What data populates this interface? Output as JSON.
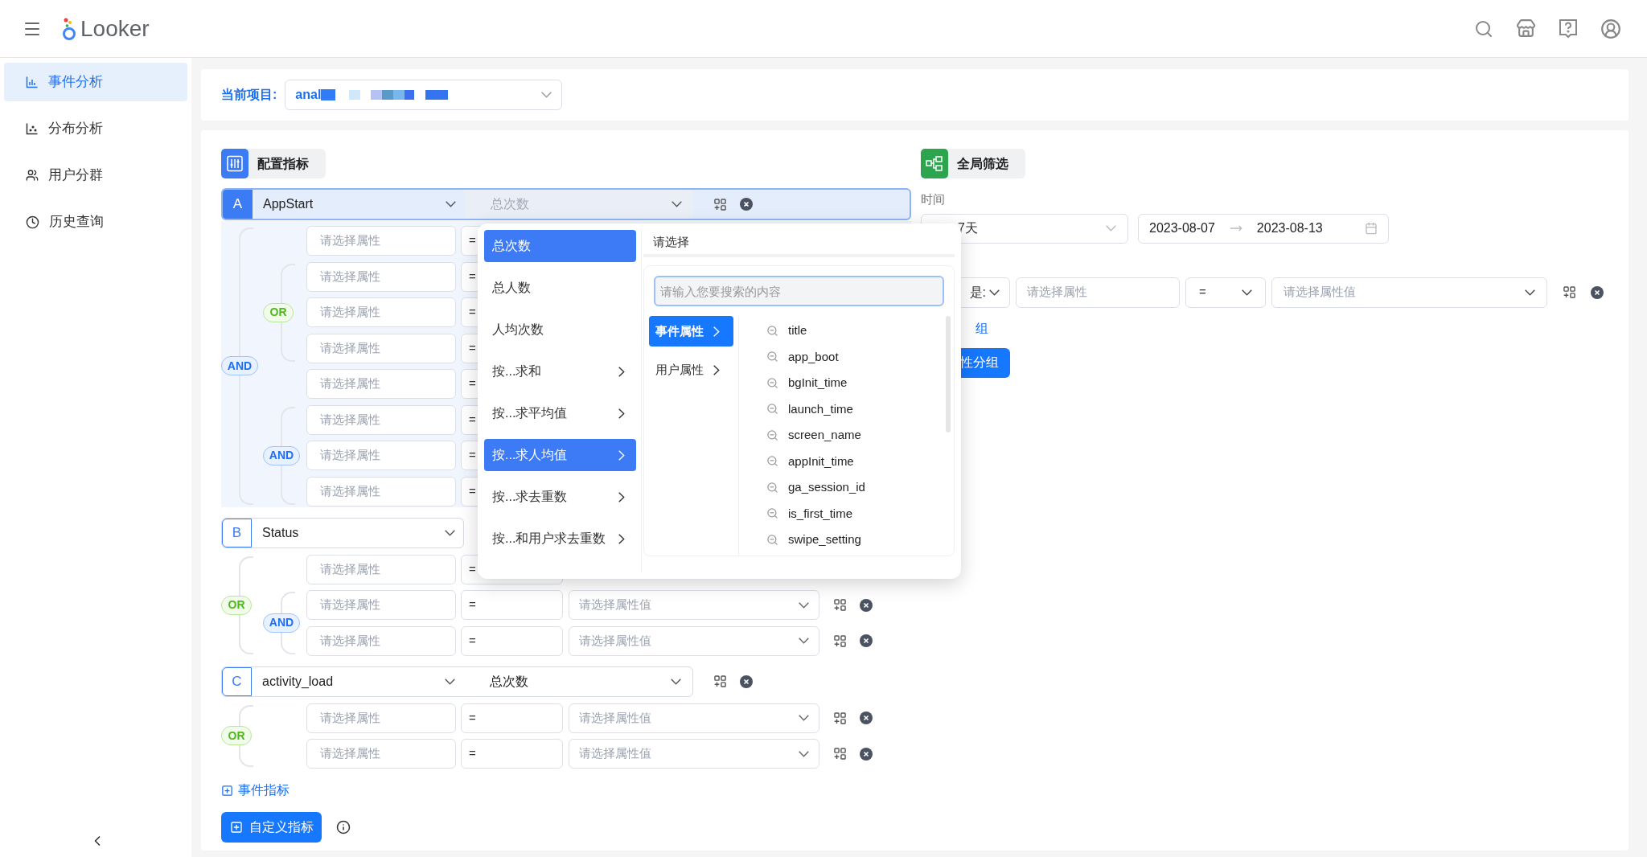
{
  "header": {
    "logo": "Looker"
  },
  "sidebar": {
    "items": [
      {
        "label": "事件分析",
        "kind": "bars",
        "selected": true
      },
      {
        "label": "分布分析",
        "kind": "scatter",
        "selected": false
      },
      {
        "label": "用户分群",
        "kind": "users",
        "selected": false
      },
      {
        "label": "历史查询",
        "kind": "clock",
        "selected": false
      }
    ]
  },
  "project": {
    "label": "当前项目:",
    "value": "anal"
  },
  "config": {
    "title": "配置指标",
    "metrics": [
      {
        "letter": "A",
        "event": "AppStart",
        "aggregate": "总次数",
        "active": true,
        "filters": {
          "kind": "and",
          "label": "AND",
          "children": [
            {
              "kind": "row",
              "property": "请选择属性",
              "operator": "="
            },
            {
              "kind": "or",
              "label": "OR",
              "children": [
                {
                  "kind": "row",
                  "property": "请选择属性",
                  "operator": "="
                },
                {
                  "kind": "row",
                  "property": "请选择属性",
                  "operator": "="
                },
                {
                  "kind": "row",
                  "property": "请选择属性",
                  "operator": "="
                }
              ]
            },
            {
              "kind": "row",
              "property": "请选择属性",
              "operator": "="
            },
            {
              "kind": "and",
              "label": "AND",
              "children": [
                {
                  "kind": "row",
                  "property": "请选择属性",
                  "operator": "="
                },
                {
                  "kind": "row",
                  "property": "请选择属性",
                  "operator": "="
                },
                {
                  "kind": "row",
                  "property": "请选择属性",
                  "operator": "="
                }
              ]
            }
          ]
        }
      },
      {
        "letter": "B",
        "event": "Status",
        "active": false,
        "filters": {
          "kind": "or",
          "label": "OR",
          "children": [
            {
              "kind": "row",
              "property": "请选择属性",
              "operator": "="
            },
            {
              "kind": "and",
              "label": "AND",
              "children": [
                {
                  "kind": "row",
                  "property": "请选择属性",
                  "operator": "=",
                  "value": "请选择属性值"
                },
                {
                  "kind": "row",
                  "property": "请选择属性",
                  "operator": "=",
                  "value": "请选择属性值"
                }
              ]
            }
          ]
        }
      },
      {
        "letter": "C",
        "event": "activity_load",
        "aggregate": "总次数",
        "active": false,
        "filters": {
          "kind": "or",
          "label": "OR",
          "children": [
            {
              "kind": "row",
              "property": "请选择属性",
              "operator": "=",
              "value": "请选择属性值"
            },
            {
              "kind": "row",
              "property": "请选择属性",
              "operator": "=",
              "value": "请选择属性值"
            }
          ]
        }
      }
    ],
    "add_metric_link": "事件指标",
    "custom_metric_button": "自定义指标"
  },
  "global_filter": {
    "title": "全局筛选",
    "time_label": "时间",
    "range": "7天",
    "start": "2023-08-07",
    "end": "2023-08-13",
    "filter": {
      "relation": "是:",
      "property": "请选择属性",
      "operator": "=",
      "value": "请选择属性值"
    },
    "group_link": "组",
    "group_button": "性分组"
  },
  "dropdown": {
    "options": [
      {
        "label": "总次数",
        "selected": true,
        "submenu": false
      },
      {
        "label": "总人数",
        "selected": false,
        "submenu": false
      },
      {
        "label": "人均次数",
        "selected": false,
        "submenu": false
      },
      {
        "label": "按...求和",
        "selected": false,
        "submenu": true
      },
      {
        "label": "按...求平均值",
        "selected": false,
        "submenu": true
      },
      {
        "label": "按...求人均值",
        "selected": true,
        "submenu": true
      },
      {
        "label": "按...求去重数",
        "selected": false,
        "submenu": true
      },
      {
        "label": "按...和用户求去重数",
        "selected": false,
        "submenu": true
      }
    ],
    "header": "请选择",
    "search_placeholder": "请输入您要搜索的内容",
    "categories": [
      {
        "label": "事件属性",
        "selected": true
      },
      {
        "label": "用户属性",
        "selected": false
      }
    ],
    "properties": [
      "title",
      "app_boot",
      "bgInit_time",
      "launch_time",
      "screen_name",
      "appInit_time",
      "ga_session_id",
      "is_first_time",
      "swipe_setting"
    ]
  }
}
